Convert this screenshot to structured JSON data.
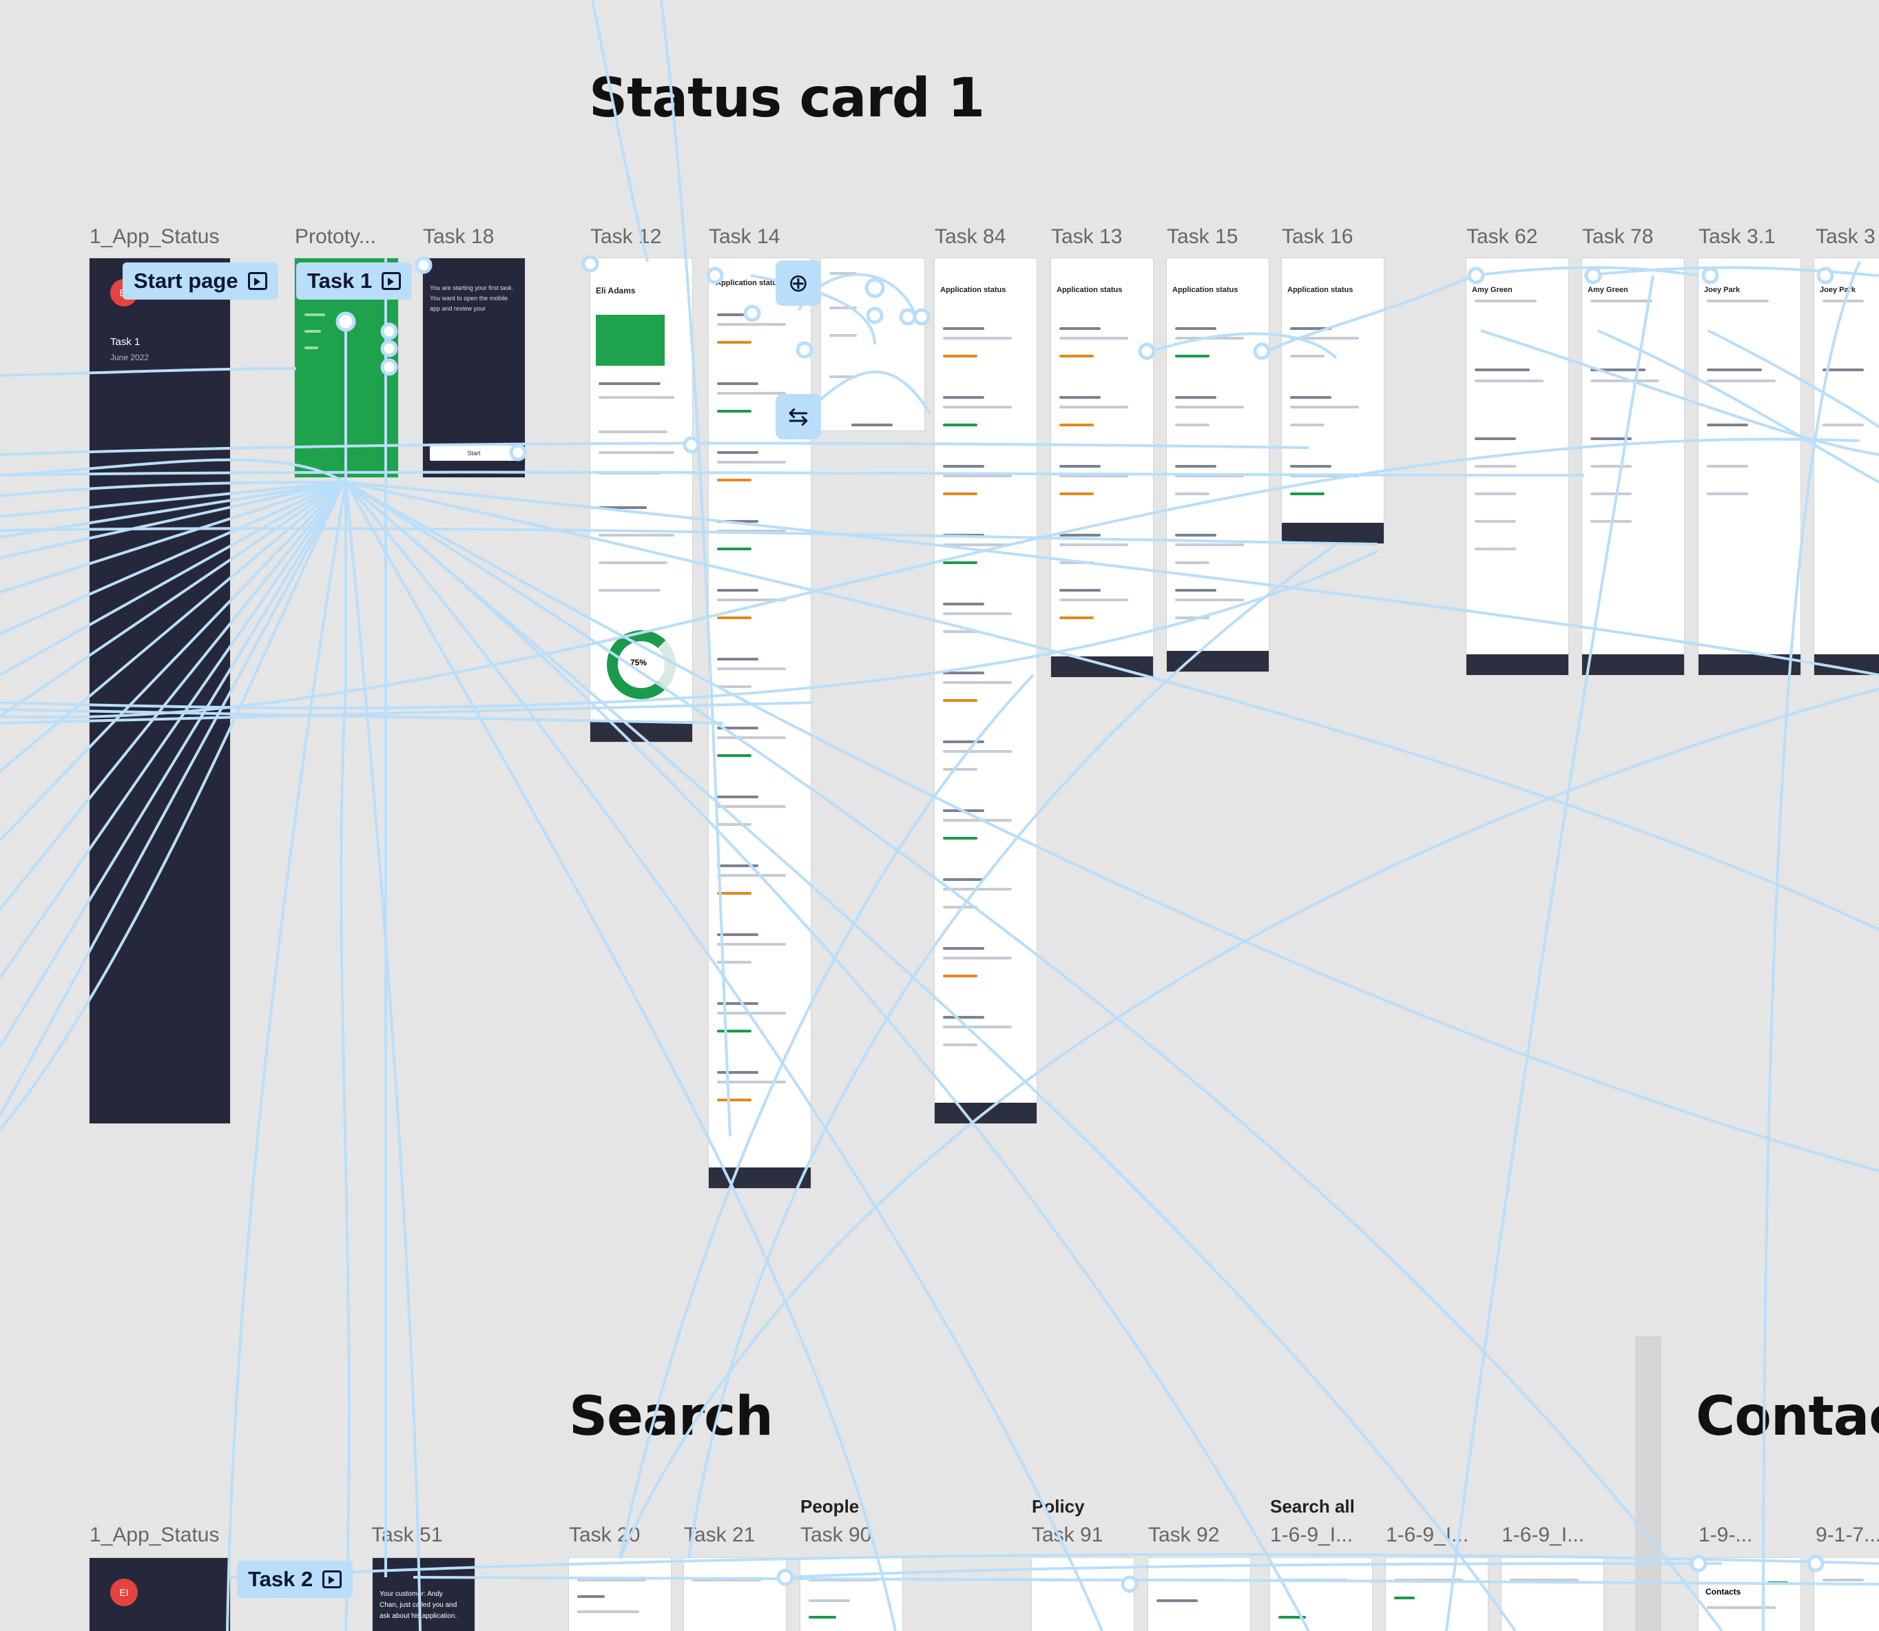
{
  "sections": {
    "status_card": "Status card 1",
    "search": "Search",
    "contact": "Contact",
    "people_label": "People",
    "policy_label": "Policy",
    "search_all_label": "Search all"
  },
  "frame_labels": {
    "app_status_top": "1_App_Status",
    "prototype": "Prototy...",
    "task18": "Task 18",
    "task12": "Task 12",
    "task14": "Task 14",
    "task84": "Task 84",
    "task13": "Task 13",
    "task15": "Task 15",
    "task16": "Task 16",
    "task62": "Task 62",
    "task78": "Task 78",
    "task31": "Task 3.1",
    "task3x": "Task 3",
    "app_status_bottom": "1_App_Status",
    "task51": "Task 51",
    "task20": "Task 20",
    "task21": "Task 21",
    "task90": "Task 90",
    "task91": "Task 91",
    "task92": "Task 92",
    "f1699a": "1-6-9_I...",
    "f1699b": "1-6-9_I...",
    "f1699c": "1-6-9_I...",
    "f19a": "1-9-...",
    "f917": "9-1-7..."
  },
  "flow_badges": {
    "start_page": "Start page",
    "task1": "Task 1",
    "task2": "Task 2"
  },
  "frame_text": {
    "task1_title": "Task 1",
    "task1_date": "June 2022",
    "task12_name": "Eli Adams",
    "task12_pct": "75%",
    "task51_line1": "Your customer: Andy",
    "task51_line2": "Chan, just called you and",
    "task51_line3": "ask about his application.",
    "avatar_initials": "EI",
    "task62_name": "Amy Green",
    "task78_name": "Amy Green",
    "task31_name": "Joey Park",
    "task3x_name": "Joey Park",
    "app_status_title": "Application status",
    "contacts_title": "Contacts",
    "task18_text": "You are starting your first task. You want to open the mobile app and review your",
    "start_label": "Start"
  },
  "colors": {
    "canvas_bg": "#e5e5e5",
    "wire": "#b9defa",
    "badge_bg": "#b9defa",
    "dark_frame": "#25283a",
    "accent_green": "#1ea34c",
    "avatar_red": "#e4433f"
  },
  "icons": {
    "flow_start": "play-frame-icon",
    "connector_add": "add-frame-icon",
    "connector_link": "link-icon"
  }
}
